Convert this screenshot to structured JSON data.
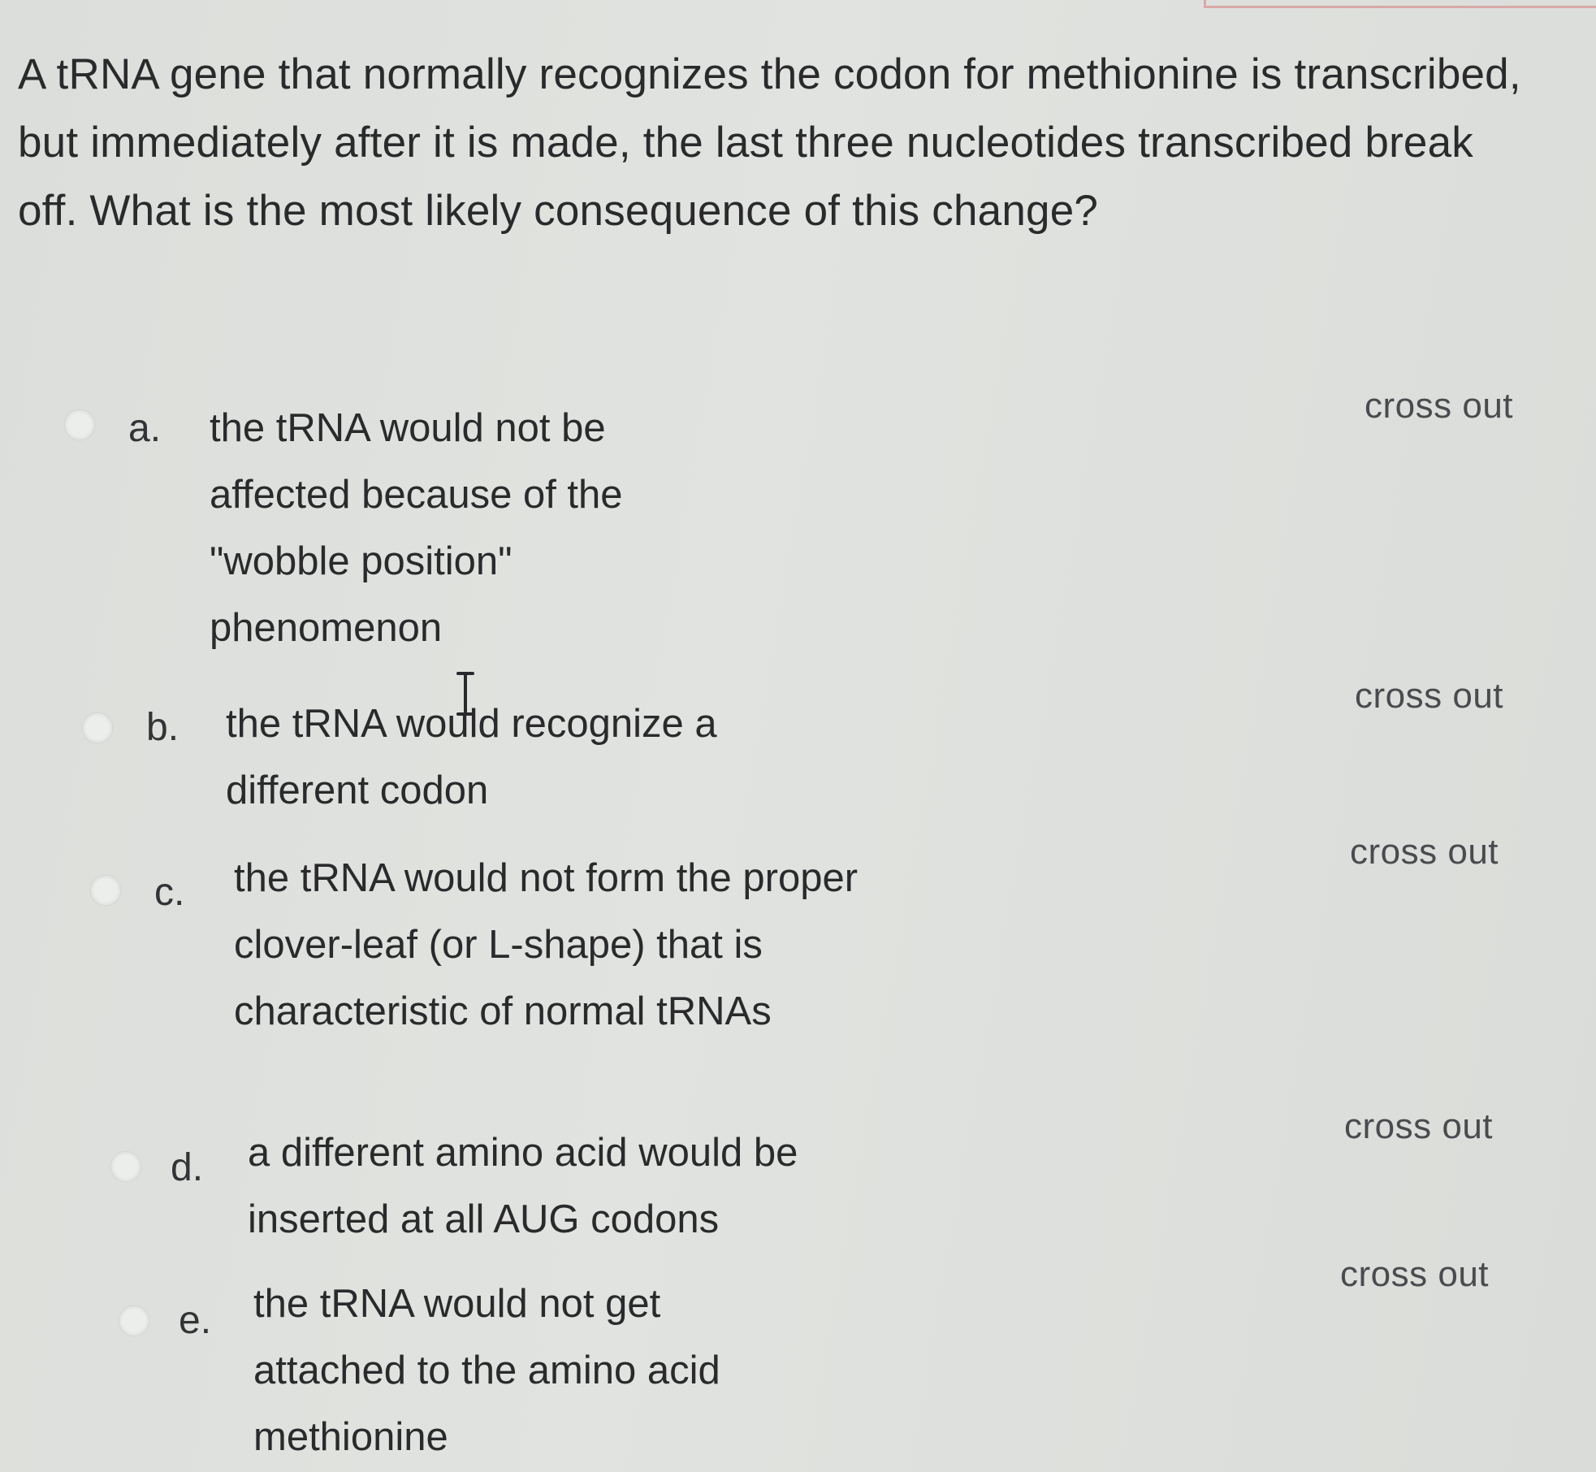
{
  "question": {
    "text": "A tRNA gene that normally recognizes the codon for methionine is transcribed, but immediately after it is made, the last three nucleotides transcribed break off. What is the most likely consequence of this change?"
  },
  "options": [
    {
      "letter": "a.",
      "text": "the tRNA would not be affected because of the \"wobble position\" phenomenon",
      "cross_out": "cross out"
    },
    {
      "letter": "b.",
      "text": "the tRNA would recognize a different codon",
      "cross_out": "cross out"
    },
    {
      "letter": "c.",
      "text": "the tRNA would not form the proper clover-leaf (or L-shape) that is characteristic of normal tRNAs",
      "cross_out": "cross out"
    },
    {
      "letter": "d.",
      "text": "a different amino acid would be inserted at all AUG codons",
      "cross_out": "cross out"
    },
    {
      "letter": "e.",
      "text": "the tRNA would not get attached to the amino acid methionine",
      "cross_out": "cross out"
    }
  ],
  "icons": {
    "cursor": "text-cursor-icon"
  }
}
